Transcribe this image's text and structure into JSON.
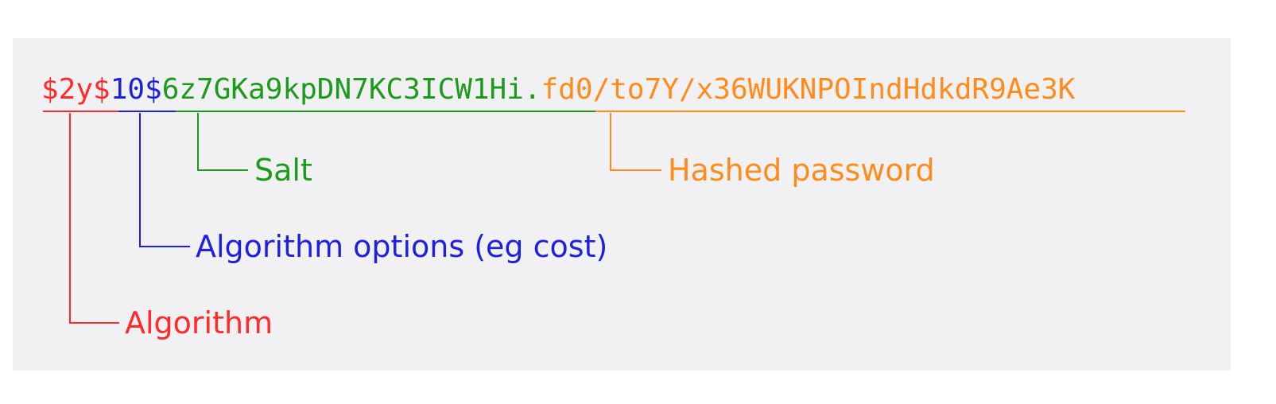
{
  "colors": {
    "algorithm": "#ff2a2a",
    "options": "#1f1fe0",
    "salt": "#1c9a1c",
    "hashed": "#ff8c1a",
    "panel": "#f1f1f3"
  },
  "hash": {
    "algorithm_part": "$2y$",
    "options_part": "10$",
    "salt_part": "6z7GKa9kpDN7KC3ICW1Hi.",
    "hashed_part": "fd0/to7Y/x36WUKNPOIndHdkdR9Ae3K"
  },
  "labels": {
    "salt": "Salt",
    "hashed": "Hashed password",
    "options": "Algorithm options (eg cost)",
    "algorithm": "Algorithm"
  }
}
